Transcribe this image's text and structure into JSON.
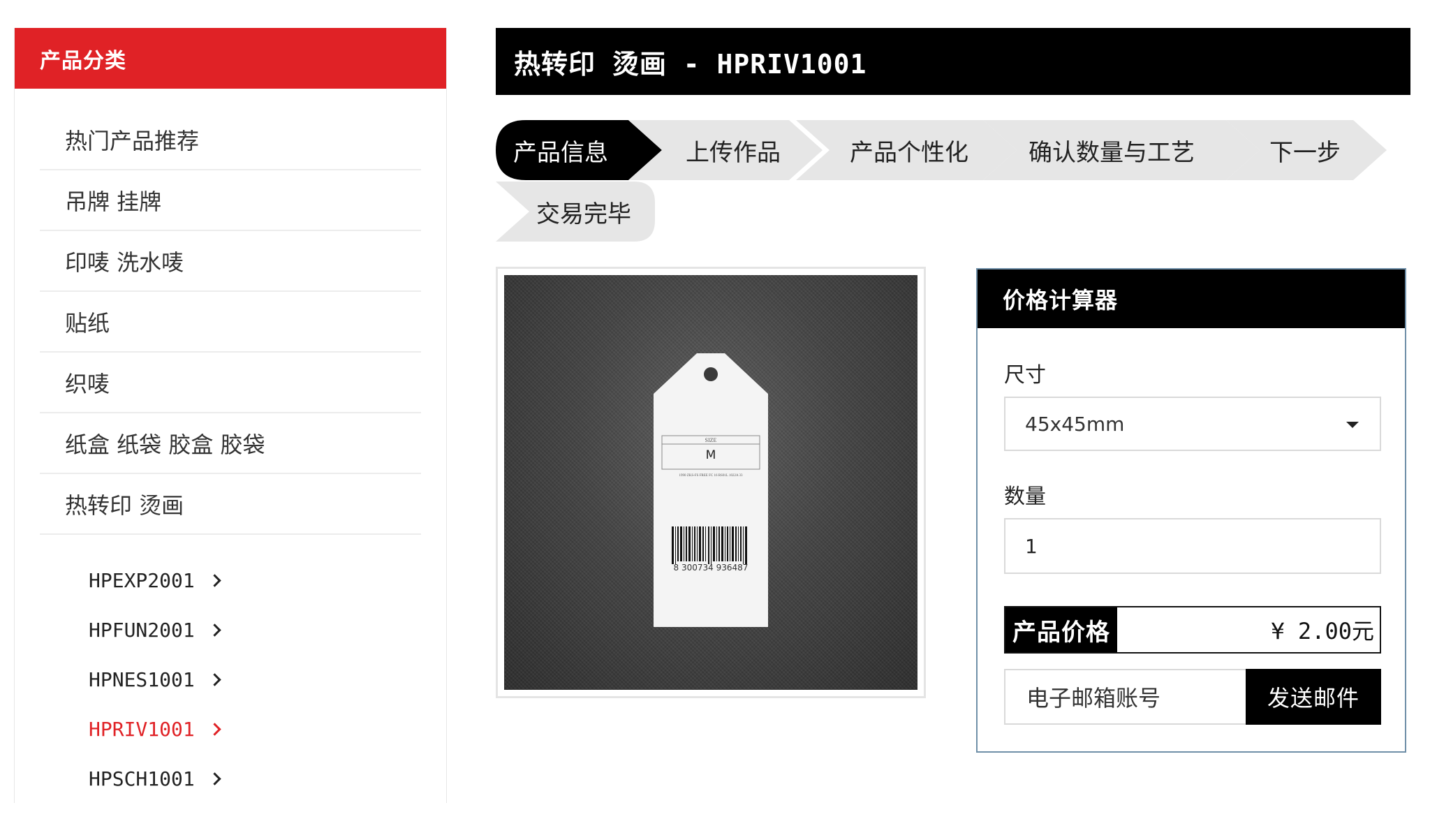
{
  "sidebar": {
    "title": "产品分类",
    "categories": [
      "热门产品推荐",
      "吊牌 挂牌",
      "印唛 洗水唛",
      "贴纸",
      "织唛",
      "纸盒 纸袋 胶盒 胶袋",
      "热转印 烫画"
    ],
    "sub_items": [
      {
        "label": "HPEXP2001",
        "active": false
      },
      {
        "label": "HPFUN2001",
        "active": false
      },
      {
        "label": "HPNES1001",
        "active": false
      },
      {
        "label": "HPRIV1001",
        "active": true
      },
      {
        "label": "HPSCH1001",
        "active": false
      }
    ]
  },
  "page_title": "热转印 烫画 - HPRIV1001",
  "steps": [
    {
      "label": "产品信息",
      "active": true
    },
    {
      "label": "上传作品",
      "active": false
    },
    {
      "label": "产品个性化",
      "active": false
    },
    {
      "label": "确认数量与工艺",
      "active": false
    },
    {
      "label": "下一步",
      "active": false
    },
    {
      "label": "交易完毕",
      "active": false
    }
  ],
  "product_image": {
    "tag_size_label": "SIZE",
    "tag_size_value": "M",
    "tag_fine_print": "1990 ZKS-FS FREE FC 16 RS01L 1022A 33",
    "barcode_number": "8 300734 936487"
  },
  "calculator": {
    "title": "价格计算器",
    "size_label": "尺寸",
    "size_value": "45x45mm",
    "quantity_label": "数量",
    "quantity_value": "1",
    "price_label": "产品价格",
    "price_value": "¥  2.00元",
    "email_placeholder": "电子邮箱账号",
    "send_label": "发送邮件"
  },
  "colors": {
    "accent_red": "#e02226",
    "black": "#000000",
    "step_inactive": "#e6e6e6",
    "calc_border": "#6f8fa8"
  }
}
